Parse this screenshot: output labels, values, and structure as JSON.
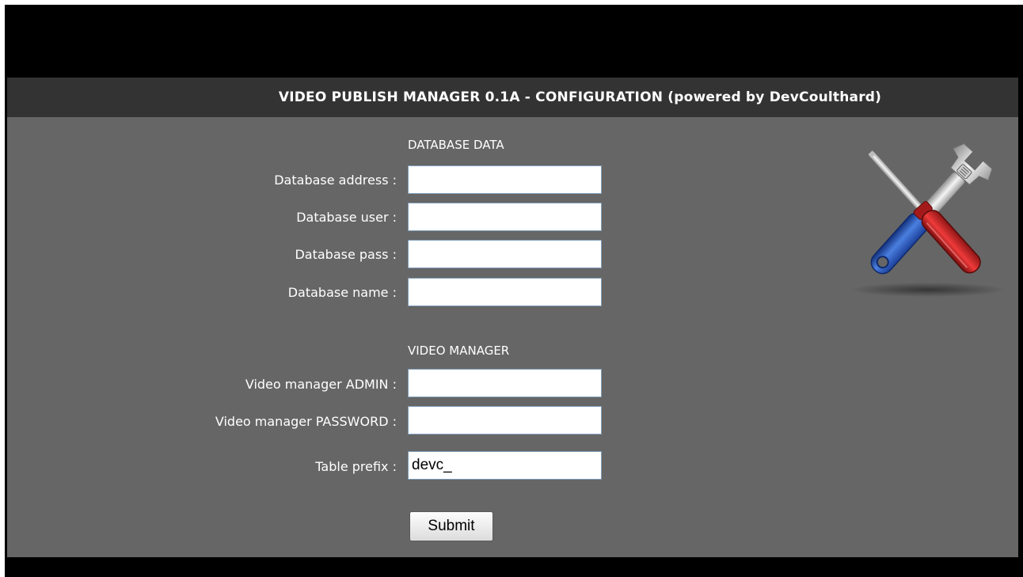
{
  "app": {
    "title": "VIDEO PUBLISH MANAGER 0.1A - CONFIGURATION (powered by DevCoulthard)"
  },
  "database": {
    "section_title": "DATABASE DATA",
    "address_label": "Database address :",
    "address_value": "",
    "user_label": "Database user :",
    "user_value": "",
    "pass_label": "Database pass :",
    "pass_value": "",
    "name_label": "Database name :",
    "name_value": ""
  },
  "video_manager": {
    "section_title": "VIDEO MANAGER",
    "admin_label": "Video manager ADMIN :",
    "admin_value": "",
    "password_label": "Video manager PASSWORD :",
    "password_value": "",
    "prefix_label": "Table prefix :",
    "prefix_value": "devc_"
  },
  "form": {
    "submit_label": "Submit"
  },
  "icons": {
    "tools": "screwdriver-and-wrench-icon"
  },
  "colors": {
    "frame": "#000000",
    "title_bar": "#333333",
    "panel": "#666666",
    "text": "#ffffff"
  }
}
